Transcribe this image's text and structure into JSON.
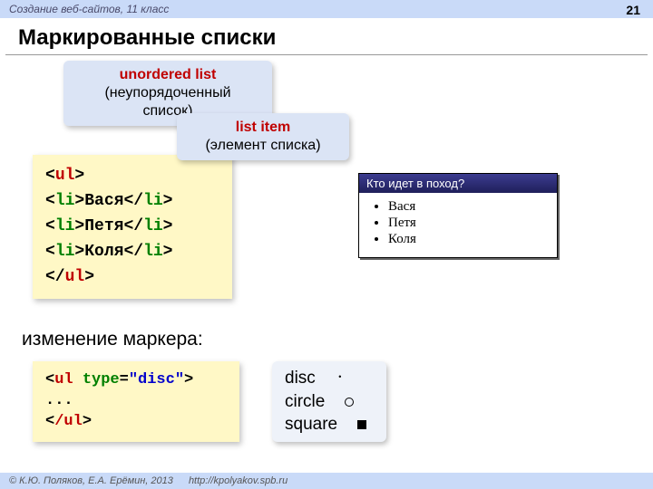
{
  "header": {
    "crumb": "Создание веб-сайтов, 11 класс",
    "page_number": "21"
  },
  "title": "Маркированные списки",
  "callouts": {
    "ul_term": "unordered list",
    "ul_translation": "(неупорядоченный список)",
    "li_term": "list item",
    "li_translation": "(элемент списка)"
  },
  "code1": {
    "open_tag": "ul",
    "items": [
      "Вася",
      "Петя",
      "Коля"
    ],
    "li_tag": "li"
  },
  "browser": {
    "window_title": "Кто идет в поход?",
    "items": [
      "Вася",
      "Петя",
      "Коля"
    ]
  },
  "subheading": "изменение маркера:",
  "code2": {
    "tag": "ul",
    "attr_name": "type",
    "attr_value": "\"disc\"",
    "ellipsis": "...",
    "close": "/ul"
  },
  "markers": {
    "disc": "disc",
    "circle": "circle",
    "square": "square"
  },
  "footer": {
    "copyright": "© К.Ю. Поляков, Е.А. Ерёмин, 2013",
    "url": "http://kpolyakov.spb.ru"
  }
}
